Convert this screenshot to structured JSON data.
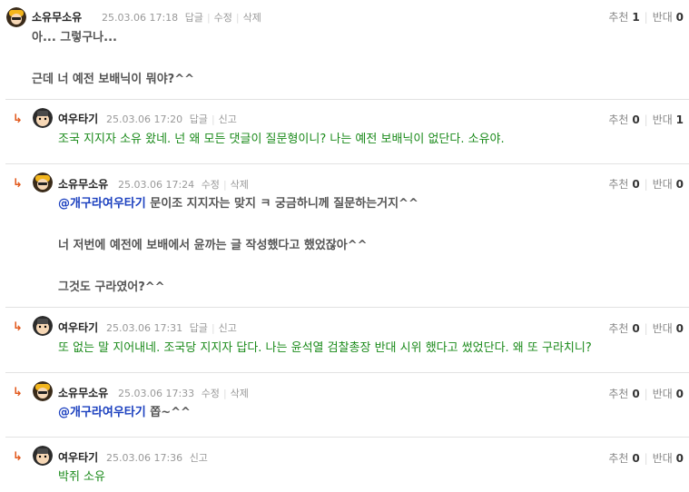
{
  "comments": [
    {
      "nick": "소유무소유",
      "date": "25.03.06 17:18",
      "actions": [
        "답글",
        "수정",
        "삭제"
      ],
      "up_label": "추천",
      "up": "1",
      "down_label": "반대",
      "down": "0",
      "lines": [
        "아... 그렇구나...",
        "",
        "근데 너 예전 보배닉이 뭐야?^^"
      ]
    },
    {
      "nick": "여우타기",
      "date": "25.03.06 17:20",
      "actions": [
        "답글",
        "신고"
      ],
      "up_label": "추천",
      "up": "0",
      "down_label": "반대",
      "down": "1",
      "lines": [
        "조국 지지자 소유 왔네. 넌 왜 모든 댓글이 질문형이니? 나는 예전 보배닉이 없단다. 소유야."
      ]
    },
    {
      "nick": "소유무소유",
      "date": "25.03.06 17:24",
      "actions": [
        "수정",
        "삭제"
      ],
      "up_label": "추천",
      "up": "0",
      "down_label": "반대",
      "down": "0",
      "mention": "@개구라여우타기",
      "lines": [
        " 문이조 지지자는 맞지 ㅋ 궁금하니께 질문하는거지^^",
        "",
        "너 저번에 예전에 보배에서 윤까는 글 작성했다고 했었잖아^^",
        "",
        "그것도 구라였어?^^"
      ]
    },
    {
      "nick": "여우타기",
      "date": "25.03.06 17:31",
      "actions": [
        "답글",
        "신고"
      ],
      "up_label": "추천",
      "up": "0",
      "down_label": "반대",
      "down": "0",
      "lines": [
        "또 없는 말 지어내네. 조국당 지지자 답다. 나는 윤석열 검찰총장 반대 시위 했다고 썼었단다. 왜 또 구라치니?"
      ]
    },
    {
      "nick": "소유무소유",
      "date": "25.03.06 17:33",
      "actions": [
        "수정",
        "삭제"
      ],
      "up_label": "추천",
      "up": "0",
      "down_label": "반대",
      "down": "0",
      "mention": "@개구라여우타기",
      "lines": [
        " 쫍~^^"
      ]
    },
    {
      "nick": "여우타기",
      "date": "25.03.06 17:36",
      "actions": [
        "신고"
      ],
      "up_label": "추천",
      "up": "0",
      "down_label": "반대",
      "down": "0",
      "lines": [
        "박쥐 소유"
      ]
    }
  ],
  "reply_arrow": "↳",
  "colors": {
    "green": "#1a8a1a",
    "mention": "#1a3fbf",
    "arrow": "#e2581b"
  }
}
